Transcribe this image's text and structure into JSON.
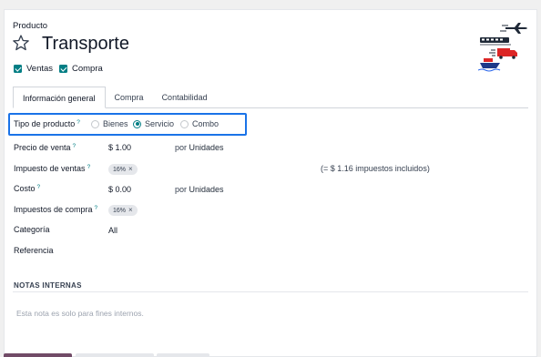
{
  "header": {
    "record_type": "Producto",
    "title": "Transporte",
    "checkboxes": [
      {
        "label": "Ventas",
        "checked": true
      },
      {
        "label": "Compra",
        "checked": true
      }
    ]
  },
  "tabs": [
    {
      "label": "Información general",
      "active": true
    },
    {
      "label": "Compra",
      "active": false
    },
    {
      "label": "Contabilidad",
      "active": false
    }
  ],
  "product_type": {
    "label": "Tipo de producto",
    "help": "?",
    "options": [
      {
        "label": "Bienes",
        "selected": false
      },
      {
        "label": "Servicio",
        "selected": true
      },
      {
        "label": "Combo",
        "selected": false
      }
    ]
  },
  "fields": {
    "sale_price": {
      "label": "Precio de venta",
      "help": "?",
      "value": "$ 1.00",
      "unit_prefix": "por",
      "unit": "Unidades"
    },
    "sales_tax": {
      "label": "Impuesto de ventas",
      "help": "?",
      "tag": "16%",
      "tag_remove": "×",
      "note": "(= $ 1.16 impuestos incluidos)"
    },
    "cost": {
      "label": "Costo",
      "help": "?",
      "value": "$ 0.00",
      "unit_prefix": "por",
      "unit": "Unidades"
    },
    "purchase_tax": {
      "label": "Impuestos de compra",
      "help": "?",
      "tag": "16%",
      "tag_remove": "×"
    },
    "category": {
      "label": "Categoría",
      "value": "All"
    },
    "reference": {
      "label": "Referencia",
      "value": ""
    }
  },
  "internal_notes": {
    "title": "NOTAS INTERNAS",
    "placeholder": "Esta nota es solo para fines internos."
  },
  "colors": {
    "accent": "#017e84",
    "highlight": "#1a73e8",
    "primary_button": "#714b67"
  },
  "icons": {
    "favorite": "star-outline-icon",
    "product_image": "transport-icon"
  }
}
